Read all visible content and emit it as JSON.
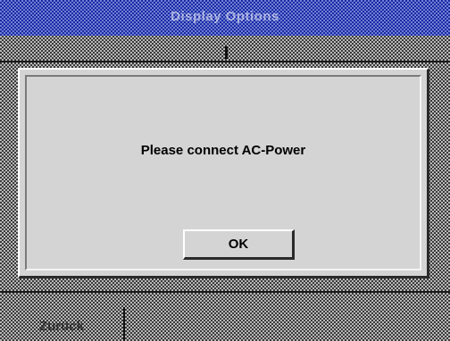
{
  "window": {
    "title": "Display Options"
  },
  "dialog": {
    "message": "Please connect AC-Power",
    "ok_label": "OK"
  },
  "footer": {
    "back_label": "Zurück"
  },
  "colors": {
    "title_bar": "#1a2aa8",
    "dialog_face": "#d4d4d4",
    "dither_dark": "#3a3a3a"
  }
}
